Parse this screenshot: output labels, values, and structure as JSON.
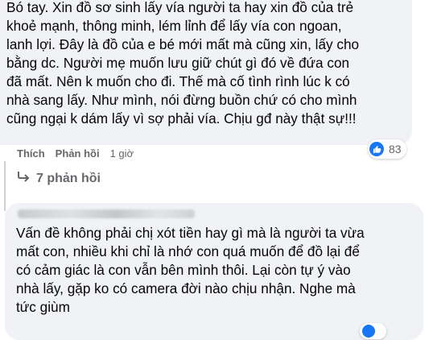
{
  "comment1": {
    "text": "Bó tay. Xin đồ sơ sinh lấy vía người ta hay xin đồ của trẻ\nkhoẻ mạnh, thông minh, lém lỉnh để lấy vía con ngoan,\nlanh lợi. Đây là đồ của e bé mới mất mà cũng xin, lấy cho\nbằng dc. Người mẹ muốn lưu giữ chút gì đó về đứa con\nđã mất. Nên k muốn cho đi. Thế mà cố tình rình lúc k có\nnhà sang lấy. Như mình, nói đừng buồn chứ có cho mình\ncũng ngại k dám lấy vì sợ phải vía. Chịu gđ này thật sự!!!",
    "actions": {
      "like_label": "Thích",
      "reply_label": "Phản hồi",
      "time": "1 giờ"
    },
    "reaction_count": "83",
    "reaction_icon": "like-icon",
    "replies_label": "7 phản hồi",
    "replies_icon": "reply-arrow-icon"
  },
  "comment2": {
    "text": "Vấn đề không phải chị xót tiền hay gì mà là người ta vừa\nmất con, nhiều khi chỉ là nhớ con quá muốn để đồ lại để\ncó cảm giác là con vẫn bên mình thôi. Lại còn tự ý vào\nnhà lấy, gặp ko có camera đời nào chịu nhận. Nghe mà\ntức giùm",
    "reaction_icon": "like-icon"
  },
  "colors": {
    "bubble": "#f0f2f5",
    "secondary_text": "#65676b",
    "like_blue": "#1877f2"
  }
}
